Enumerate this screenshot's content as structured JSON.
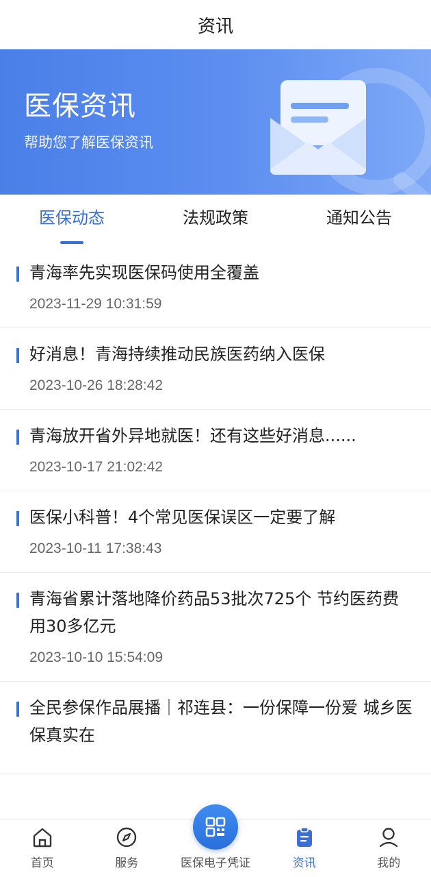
{
  "header": {
    "title": "资讯"
  },
  "banner": {
    "title": "医保资讯",
    "subtitle": "帮助您了解医保资讯"
  },
  "tabs": [
    {
      "label": "医保动态",
      "active": true
    },
    {
      "label": "法规政策",
      "active": false
    },
    {
      "label": "通知公告",
      "active": false
    }
  ],
  "news": [
    {
      "title": "青海率先实现医保码使用全覆盖",
      "time": "2023-11-29 10:31:59"
    },
    {
      "title": "好消息！青海持续推动民族医药纳入医保",
      "time": "2023-10-26 18:28:42"
    },
    {
      "title": "青海放开省外异地就医！还有这些好消息......",
      "time": "2023-10-17 21:02:42"
    },
    {
      "title": "医保小科普！4个常见医保误区一定要了解",
      "time": "2023-10-11 17:38:43"
    },
    {
      "title": "青海省累计落地降价药品53批次725个 节约医药费用30多亿元",
      "time": "2023-10-10 15:54:09"
    },
    {
      "title": "全民参保作品展播｜祁连县：一份保障一份爱 城乡医保真实在",
      "time": ""
    }
  ],
  "bottom_nav": {
    "home": "首页",
    "service": "服务",
    "ecard": "医保电子凭证",
    "news": "资讯",
    "mine": "我的"
  },
  "colors": {
    "accent": "#3b6fd8",
    "banner_start": "#4a7fe8",
    "banner_end": "#7ea9f7"
  },
  "icons": {
    "home": "home-icon",
    "service": "compass-icon",
    "ecard": "qr-code-icon",
    "news": "clipboard-icon",
    "mine": "user-icon"
  }
}
